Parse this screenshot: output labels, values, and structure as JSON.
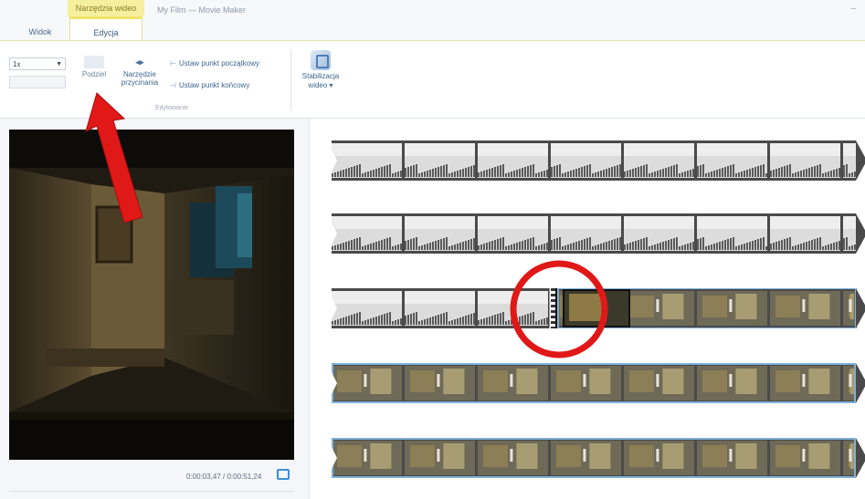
{
  "titlebar": {
    "contextual_group": "Narzędzia wideo",
    "window_title": "My Film — Movie Maker",
    "minimize_glyph": "–"
  },
  "tabs": [
    {
      "label": "Widok",
      "active": false
    },
    {
      "label": "Edycja",
      "active": true
    }
  ],
  "ribbon": {
    "speed_value": "1x",
    "split_label": "Podziel",
    "trim_label": "Narzędzie przycinania",
    "set_start_label": "Ustaw punkt początkowy",
    "set_end_label": "Ustaw punkt końcowy",
    "group_label": "Edytowanie",
    "stabilize_label_line1": "Stabilizacja",
    "stabilize_label_line2": "wideo ▾"
  },
  "preview": {
    "time_readout": "0:00:03,47 / 0:00:51,24"
  },
  "storyboard": {
    "rows": [
      {
        "type": "sky"
      },
      {
        "type": "sky"
      },
      {
        "type": "mixed",
        "split": true
      },
      {
        "type": "interior"
      },
      {
        "type": "interior"
      }
    ]
  },
  "icons": {
    "split": "split-icon",
    "trim": "trim-icon",
    "set_start": "start-point-icon",
    "set_end": "end-point-icon",
    "stabilize": "stabilize-icon",
    "fullscreen": "fullscreen-icon"
  },
  "colors": {
    "contextual_tab": "#f6ef9d",
    "annotation_red": "#e01818",
    "clip_selected_border": "#7fb0d8"
  }
}
